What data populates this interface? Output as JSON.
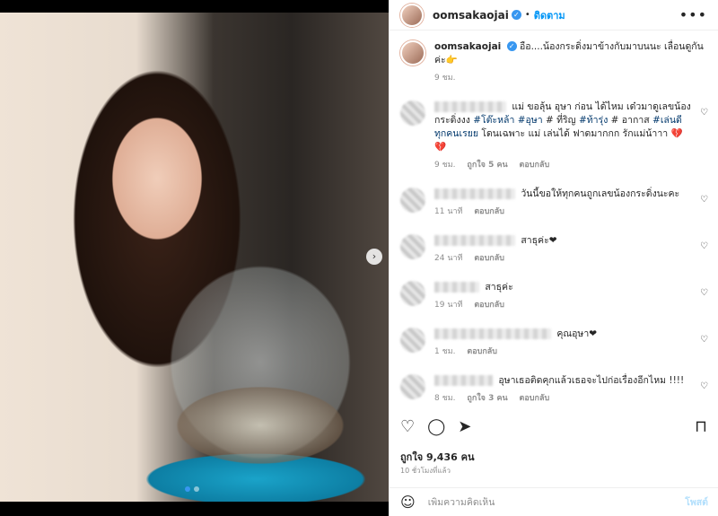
{
  "post": {
    "username": "oomsakaojai",
    "follow_label": "ติดตาม",
    "separator": "•",
    "caption": "อือ....น้องกระดิ่งมาข้างกับมาบนนะ เลื่อนดูกันค่ะ👉",
    "caption_time": "9 ชม.",
    "likes": "ถูกใจ 9,436 คน",
    "posted_ago": "10 ชั่วโมงที่แล้ว",
    "add_comment_placeholder": "เพิ่มความคิดเห็น",
    "post_label": "โพสต์"
  },
  "comments": [
    {
      "text_before": "แม่ ขอลุ้น อุษา ก่อน ได้ไหม เด๋วมาดูเลขน้องกระดิ่งงง ",
      "tag1": "#โต๊ะหล้า",
      "tag2": "#อุษา",
      "text_mid": " # ที่ริญ ",
      "tag3": "#ท้ารุ่ง",
      "text_mid2": " # อากาส ",
      "tag4": "#เล่นดีทุกคนเรยย",
      "text_after": " โดนเฉพาะ แม่ เล่นได้ ฟาดมากกก รักแม่น้าาา 💔💔",
      "time": "9 ชม.",
      "likes": "ถูกใจ 5 คน",
      "reply": "ตอบกลับ"
    },
    {
      "text": "วันนี้ขอให้ทุกคนถูกเลขน้องกระดิ่งนะคะ",
      "time": "11 นาที",
      "reply": "ตอบกลับ"
    },
    {
      "text": "สาธุค่ะ❤",
      "time": "24 นาที",
      "reply": "ตอบกลับ"
    },
    {
      "text": "สาธุค่ะ",
      "time": "19 นาที",
      "reply": "ตอบกลับ"
    },
    {
      "text": "คุณอุษา❤",
      "time": "1 ชม.",
      "reply": "ตอบกลับ"
    },
    {
      "text": "อุษาเธอติดคุกแล้วเธอจะไปก่อเรื่องอีกไหม !!!!",
      "time": "8 ชม.",
      "likes": "ถูกใจ 3 คน",
      "reply": "ตอบกลับ"
    }
  ],
  "icons": {
    "heart": "♡",
    "comment": "◯",
    "share": "➤",
    "save": "⊓",
    "emoji": "☺",
    "more": "•••",
    "next": "›",
    "verified": "✓"
  },
  "colors": {
    "accent": "#0095f6",
    "verified": "#3897f0",
    "heart_red": "#e0245e"
  }
}
